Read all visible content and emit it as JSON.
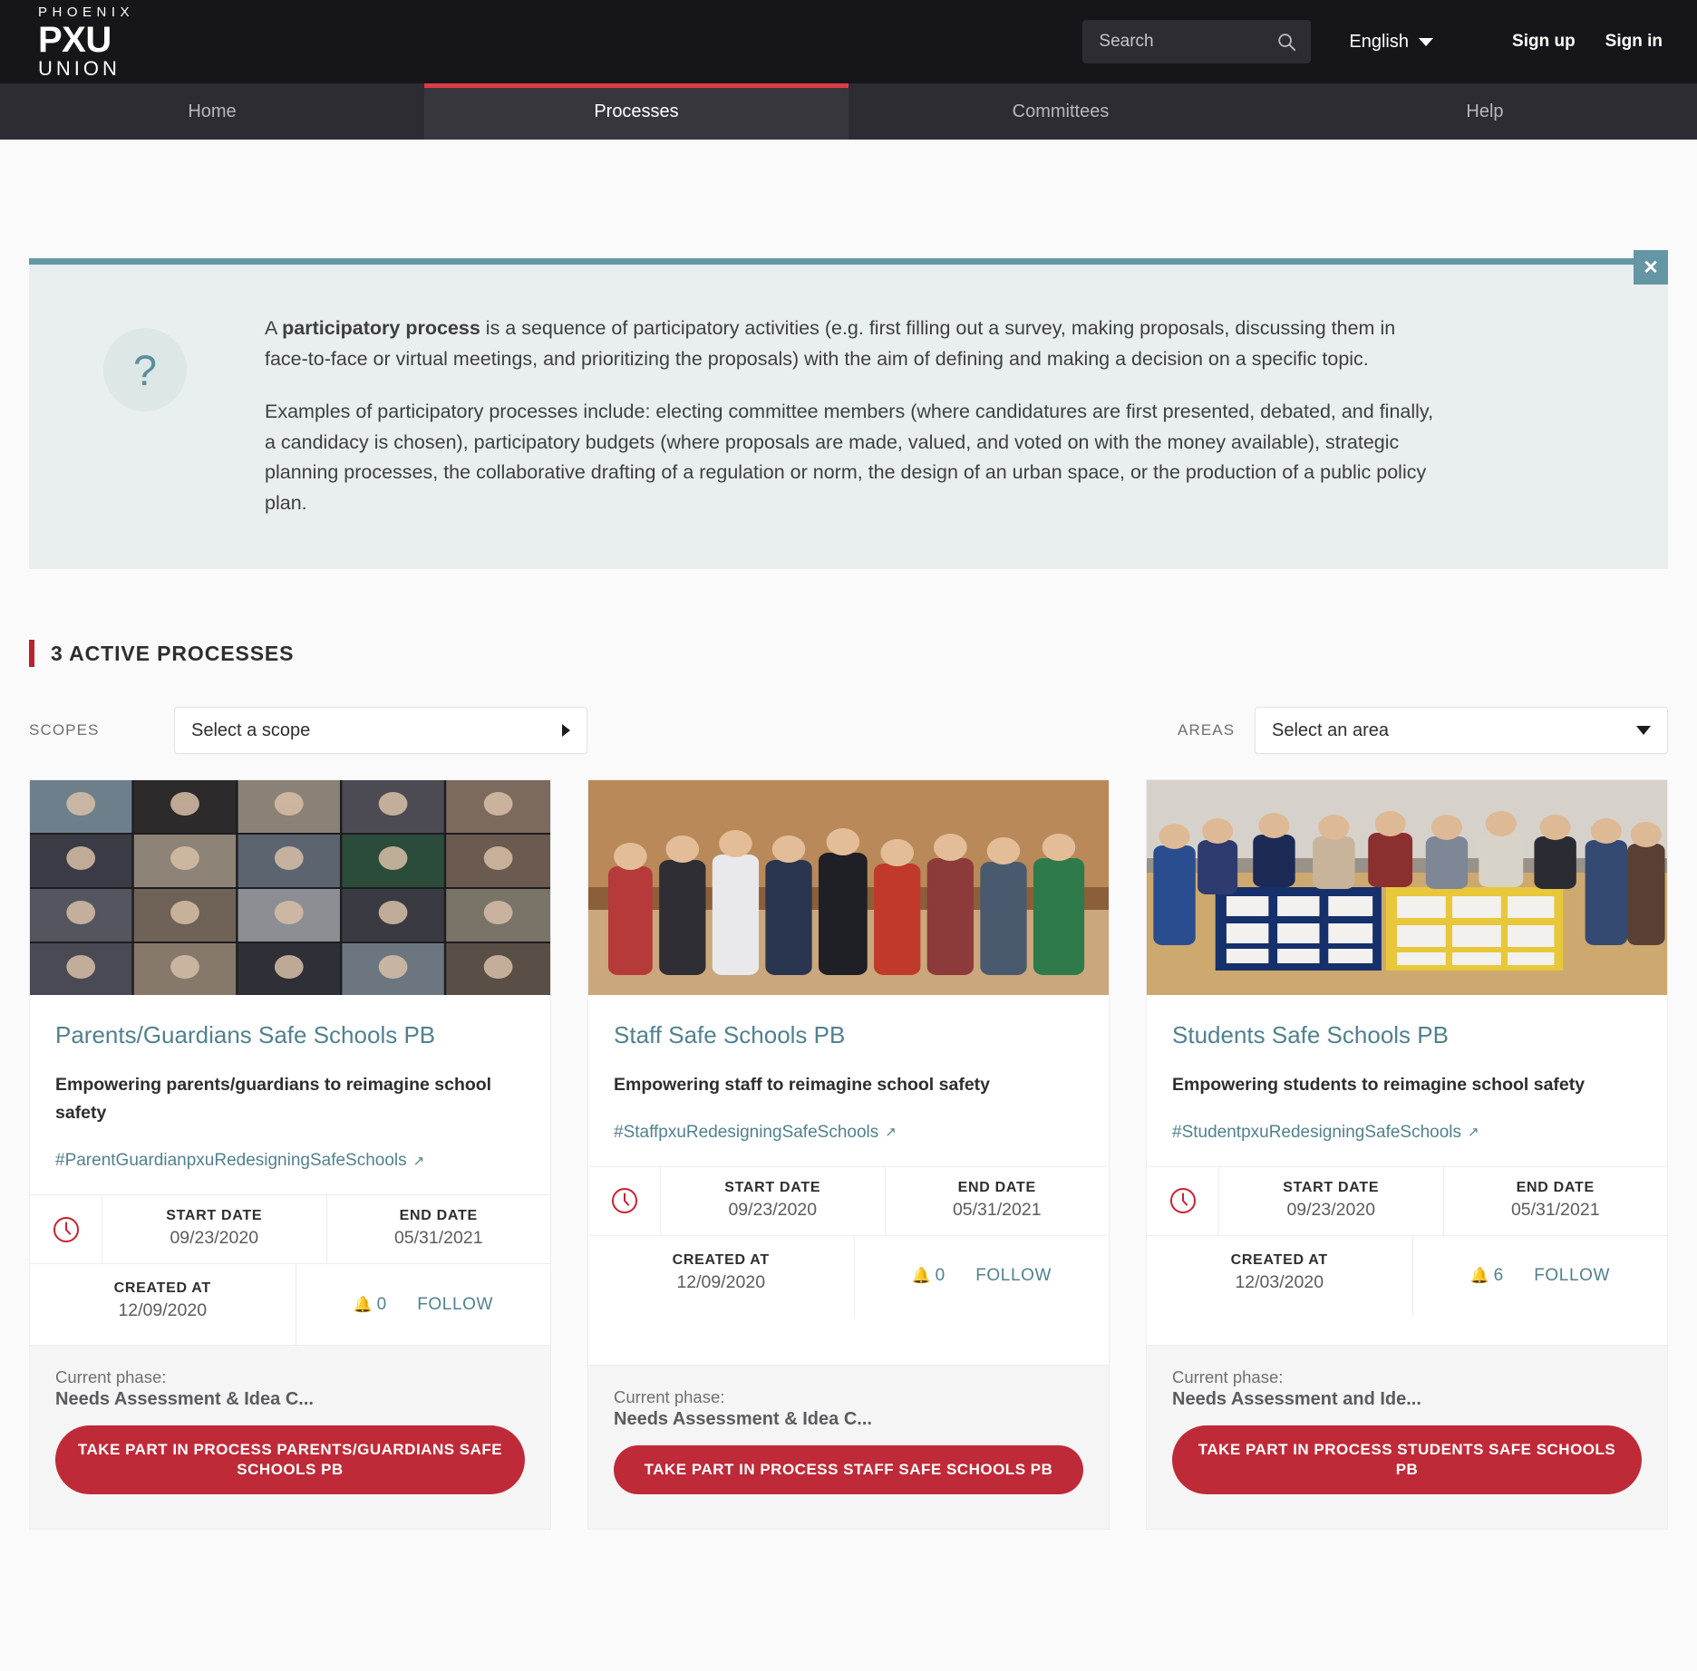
{
  "header": {
    "logo": {
      "line1": "PHOENIX",
      "line2": "PXU",
      "line3": "UNION"
    },
    "search_placeholder": "Search",
    "search_value": "",
    "search_icon": "search-icon",
    "language": "English",
    "sign_up": "Sign up",
    "sign_in": "Sign in"
  },
  "nav": {
    "tabs": [
      {
        "label": "Home",
        "active": false
      },
      {
        "label": "Processes",
        "active": true
      },
      {
        "label": "Committees",
        "active": false
      },
      {
        "label": "Help",
        "active": false
      }
    ]
  },
  "callout": {
    "icon": "?",
    "close_label": "✕",
    "paragraph1_lead": "A ",
    "paragraph1_bold": "participatory process",
    "paragraph1_rest": " is a sequence of participatory activities (e.g. first filling out a survey, making proposals, discussing them in face-to-face or virtual meetings, and prioritizing the proposals) with the aim of defining and making a decision on a specific topic.",
    "paragraph2": "Examples of participatory processes include: electing committee members (where candidatures are first presented, debated, and finally, a candidacy is chosen), participatory budgets (where proposals are made, valued, and voted on with the money available), strategic planning processes, the collaborative drafting of a regulation or norm, the design of an urban space, or the production of a public policy plan."
  },
  "section": {
    "title": "3 ACTIVE PROCESSES"
  },
  "filters": {
    "scopes_label": "SCOPES",
    "scope_value": "Select a scope",
    "areas_label": "AREAS",
    "area_value": "Select an area"
  },
  "labels": {
    "start_date": "START DATE",
    "end_date": "END DATE",
    "created_at": "CREATED AT",
    "follow": "FOLLOW",
    "current_phase": "Current phase:"
  },
  "colors": {
    "accent_red": "#bf2a38",
    "nav_active_red": "#dd3c47",
    "teal": "#50818e",
    "callout_border": "#6596a6",
    "callout_bg": "#e9efee",
    "header_bg": "#16161a",
    "nav_bg": "#2e2c33"
  },
  "cards": [
    {
      "image_alt": "video-call-grid-photo",
      "title": "Parents/Guardians Safe Schools PB",
      "subtitle": "Empowering parents/guardians to reimagine school safety",
      "hashtag": "#ParentGuardianpxuRedesigningSafeSchools",
      "start_date": "09/23/2020",
      "end_date": "05/31/2021",
      "created_at": "12/09/2020",
      "follow_count": "0",
      "phase": "Needs Assessment & Idea C...",
      "cta": "TAKE PART IN PROCESS PARENTS/GUARDIANS SAFE SCHOOLS PB"
    },
    {
      "image_alt": "staff-group-photo",
      "title": "Staff Safe Schools PB",
      "subtitle": "Empowering staff to reimagine school safety",
      "hashtag": "#StaffpxuRedesigningSafeSchools",
      "start_date": "09/23/2020",
      "end_date": "05/31/2021",
      "created_at": "12/09/2020",
      "follow_count": "0",
      "phase": "Needs Assessment & Idea C...",
      "cta": "TAKE PART IN PROCESS STAFF SAFE SCHOOLS PB"
    },
    {
      "image_alt": "students-posterboard-photo",
      "title": "Students Safe Schools PB",
      "subtitle": "Empowering students to reimagine school safety",
      "hashtag": "#StudentpxuRedesigningSafeSchools",
      "start_date": "09/23/2020",
      "end_date": "05/31/2021",
      "created_at": "12/03/2020",
      "follow_count": "6",
      "phase": "Needs Assessment and Ide...",
      "cta": "TAKE PART IN PROCESS STUDENTS SAFE SCHOOLS PB"
    }
  ]
}
